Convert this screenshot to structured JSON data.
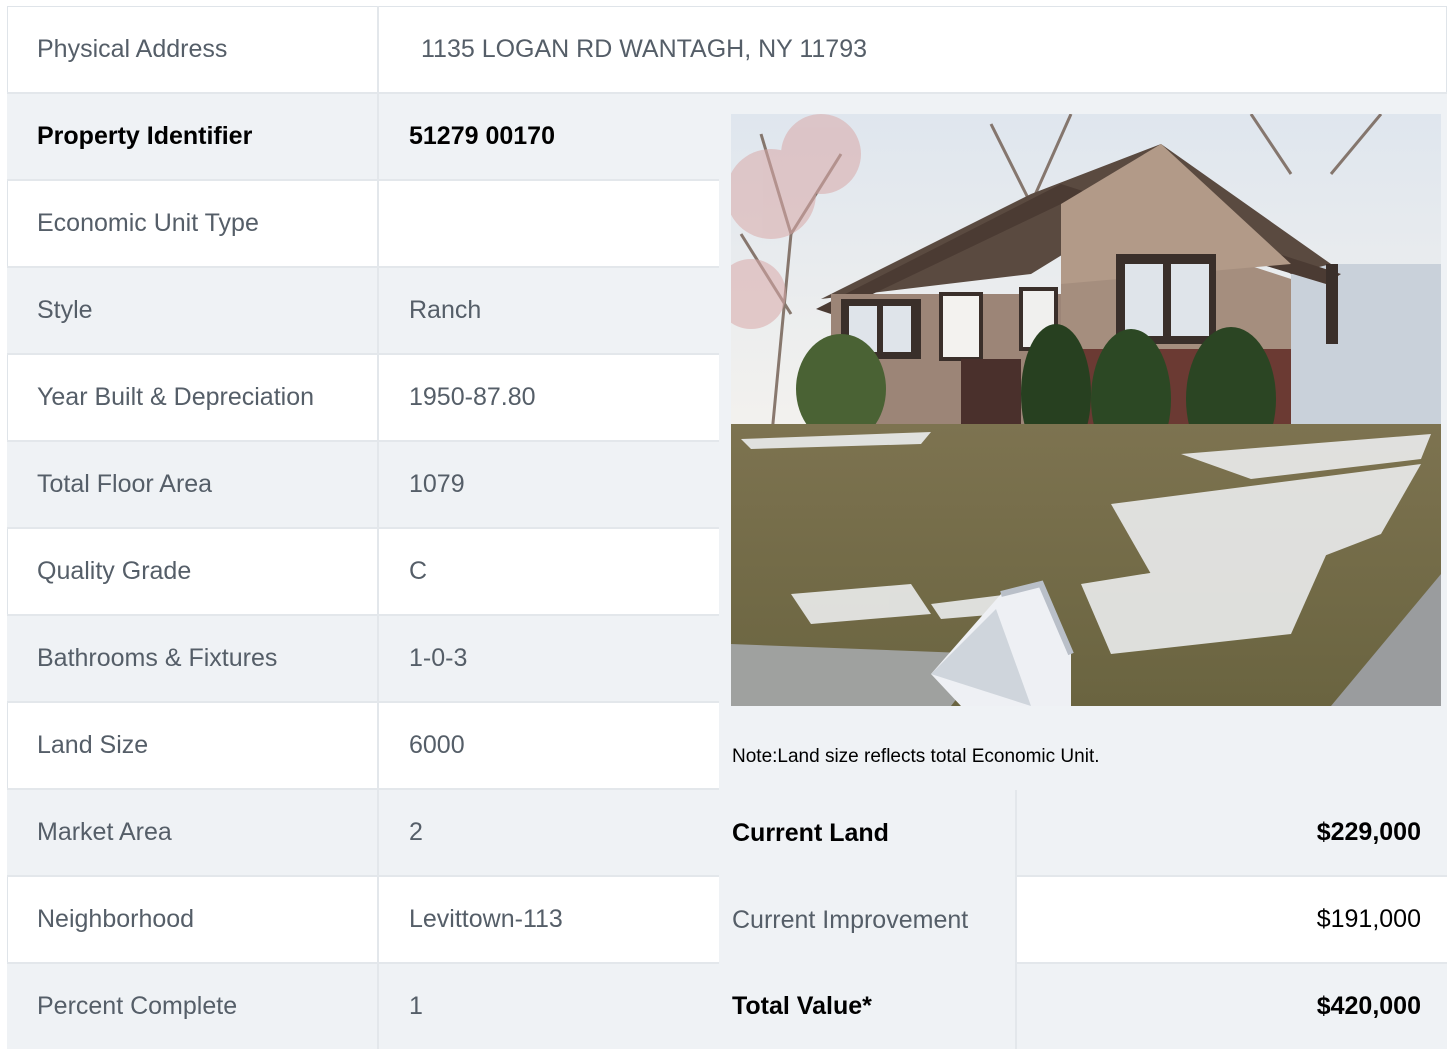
{
  "address": {
    "label": "Physical Address",
    "value": "1135  LOGAN RD  WANTAGH, NY  11793"
  },
  "details": [
    {
      "label": "Property Identifier",
      "value": "51279  00170"
    },
    {
      "label": "Economic Unit Type",
      "value": ""
    },
    {
      "label": "Style",
      "value": "Ranch"
    },
    {
      "label": "Year Built & Depreciation",
      "value": "1950-87.80"
    },
    {
      "label": "Total Floor Area",
      "value": "1079"
    },
    {
      "label": "Quality Grade",
      "value": "C"
    },
    {
      "label": "Bathrooms & Fixtures",
      "value": "1-0-3"
    },
    {
      "label": "Land Size",
      "value": "6000"
    },
    {
      "label": "Market Area",
      "value": "2"
    },
    {
      "label": "Neighborhood",
      "value": "Levittown-113"
    },
    {
      "label": "Percent Complete",
      "value": "1"
    }
  ],
  "note": "Note:Land size reflects total Economic Unit.",
  "values": [
    {
      "label": "Current Land",
      "value": "$229,000"
    },
    {
      "label": "Current Improvement",
      "value": "$191,000"
    },
    {
      "label": "Total Value*",
      "value": "$420,000"
    }
  ],
  "photo": {
    "icon": "house-photo"
  }
}
